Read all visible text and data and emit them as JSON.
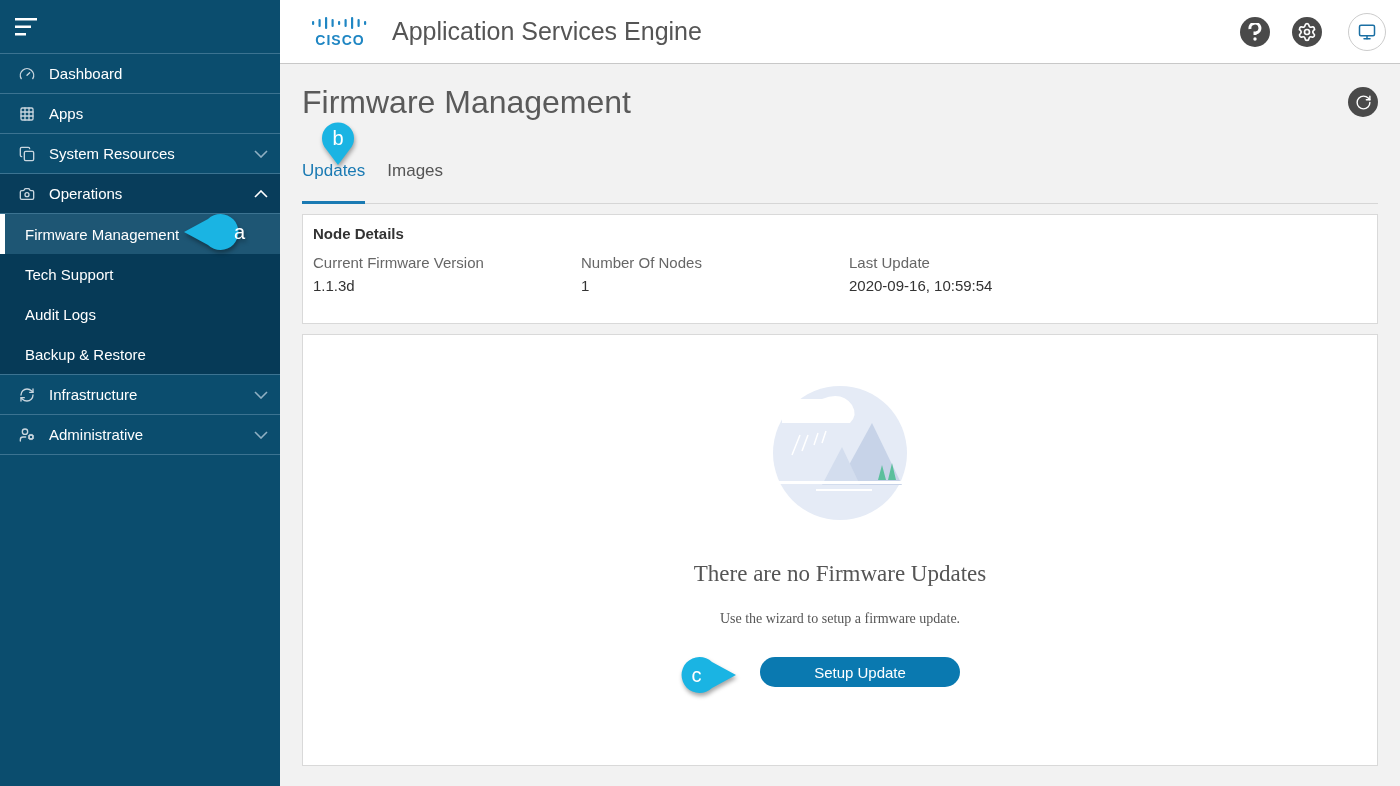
{
  "sidebar": {
    "items": [
      {
        "label": "Dashboard"
      },
      {
        "label": "Apps"
      },
      {
        "label": "System Resources",
        "expanded": false
      },
      {
        "label": "Operations",
        "expanded": true,
        "children": [
          {
            "label": "Firmware Management",
            "selected": true
          },
          {
            "label": "Tech Support",
            "selected": false
          },
          {
            "label": "Audit Logs",
            "selected": false
          },
          {
            "label": "Backup & Restore",
            "selected": false
          }
        ]
      },
      {
        "label": "Infrastructure",
        "expanded": false
      },
      {
        "label": "Administrative",
        "expanded": false
      }
    ]
  },
  "header": {
    "logo_text": "CISCO",
    "title": "Application Services Engine"
  },
  "page": {
    "title": "Firmware Management"
  },
  "tabs": [
    {
      "label": "Updates",
      "selected": true
    },
    {
      "label": "Images",
      "selected": false
    }
  ],
  "node_details": {
    "title": "Node Details",
    "fields": [
      {
        "label": "Current Firmware Version",
        "value": "1.1.3d"
      },
      {
        "label": "Number Of Nodes",
        "value": "1"
      },
      {
        "label": "Last Update",
        "value": "2020-09-16, 10:59:54"
      }
    ]
  },
  "empty_state": {
    "title": "There are no Firmware Updates",
    "message": "Use the wizard to setup a firmware update.",
    "button": "Setup Update"
  },
  "callouts": [
    "a",
    "b",
    "c"
  ]
}
